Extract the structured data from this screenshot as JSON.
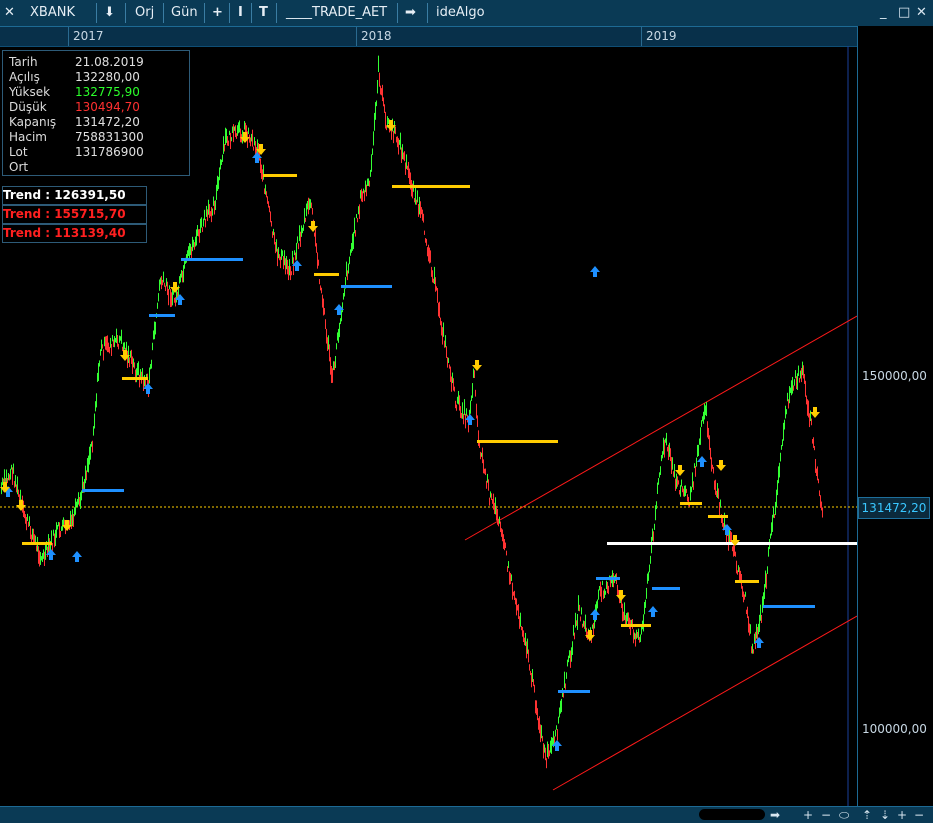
{
  "toolbar": {
    "close": "✕",
    "symbol": "XBANK",
    "down_arrow": "⬇",
    "orj": "Orj",
    "period": "Gün",
    "plus": "+",
    "cursor": "I",
    "text_tool": "T",
    "system": "____TRADE_AET",
    "right_arrow": "➡",
    "provider": "ideAlgo",
    "minimize": "_",
    "restore": "□",
    "close_window": "✕"
  },
  "years": [
    "2017",
    "2018",
    "2019"
  ],
  "info": [
    {
      "key": "Tarih",
      "value": "21.08.2019",
      "color": "#e0e0e0"
    },
    {
      "key": "Açılış",
      "value": "132280,00",
      "color": "#e0e0e0"
    },
    {
      "key": "Yüksek",
      "value": "132775,90",
      "color": "#2bff2b"
    },
    {
      "key": "Düşük",
      "value": "130494,70",
      "color": "#ff3030"
    },
    {
      "key": "Kapanış",
      "value": "131472,20",
      "color": "#e0e0e0"
    },
    {
      "key": "Hacim",
      "value": "758831300",
      "color": "#e0e0e0"
    },
    {
      "key": "Lot",
      "value": "131786900",
      "color": "#e0e0e0"
    },
    {
      "key": "Ort",
      "value": "",
      "color": "#e0e0e0"
    }
  ],
  "trends": [
    {
      "label": "Trend  :  126391,50",
      "color": "#ffffff"
    },
    {
      "label": "Trend  :  155715,70",
      "color": "#ff2020"
    },
    {
      "label": "Trend  :  113139,40",
      "color": "#ff2020"
    }
  ],
  "axis": {
    "labels": [
      "150000,00",
      "100000,00"
    ],
    "current_price": "131472,20"
  },
  "bottom": {
    "arrow": "➡",
    "zoom_in": "+",
    "zoom_out": "−",
    "fit": "⬭",
    "up": "⇡",
    "down": "⇣",
    "plus": "+",
    "minus": "−"
  },
  "colors": {
    "up": "#33ff33",
    "down": "#ff3333",
    "buy_signal": "#1e90ff",
    "sell_signal": "#ffcc00",
    "channel": "#ff1a1a",
    "support": "#ffffff",
    "price_line": "#ffd000",
    "axis_text": "#c8d8e4"
  }
}
